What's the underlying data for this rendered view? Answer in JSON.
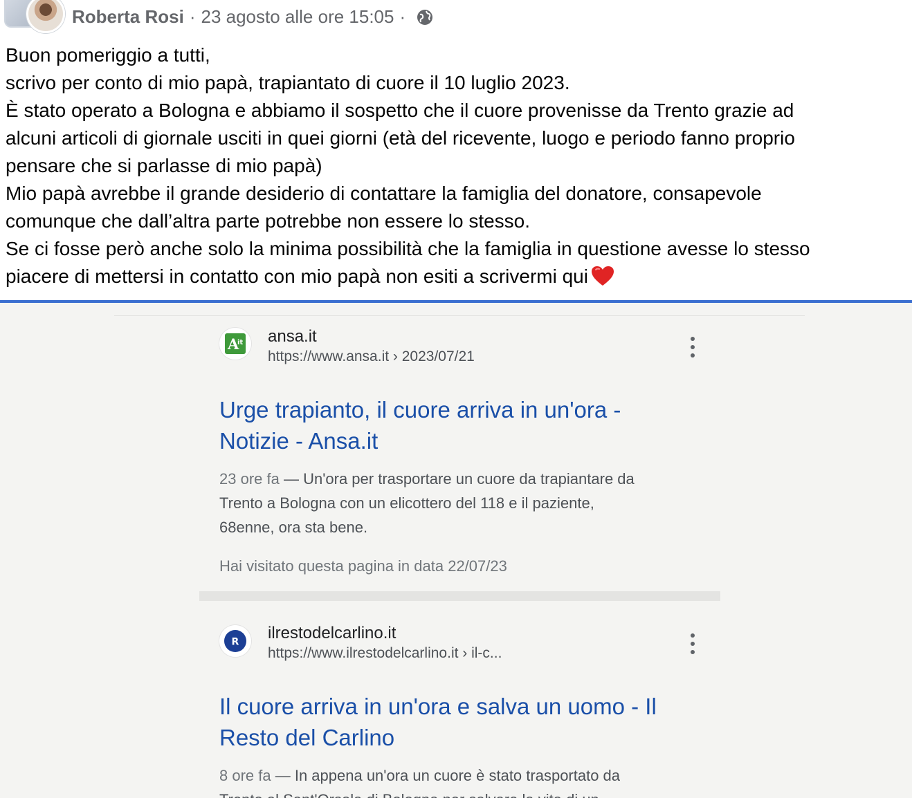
{
  "header": {
    "author": "Roberta Rosi",
    "separator": "·",
    "timestamp": "23 agosto alle ore 15:05"
  },
  "post": {
    "lines": [
      "Buon pomeriggio a tutti,",
      "scrivo per conto di mio papà, trapiantato di cuore il 10 luglio 2023.",
      "È stato operato a Bologna e abbiamo il sospetto che il cuore provenisse da Trento grazie ad",
      "alcuni articoli di giornale usciti in quei giorni (età del ricevente, luogo e periodo fanno proprio",
      "pensare che si parlasse di mio papà)",
      "Mio papà avrebbe il grande desiderio di contattare la famiglia del donatore, consapevole",
      "comunque che dall’altra parte potrebbe non essere lo stesso.",
      "Se ci fosse però anche solo la minima possibilità che la famiglia in questione avesse lo stesso",
      "piacere di mettersi in contatto con mio papà non esiti a scrivermi qui"
    ],
    "emoji": "heart-icon"
  },
  "search_results": [
    {
      "favicon_text": "A",
      "favicon_sub": "it",
      "favicon_color": "#3f9a3b",
      "site": "ansa.it",
      "url": "https://www.ansa.it › 2023/07/21",
      "title_line1": "Urge trapianto, il cuore arriva in un'ora -",
      "title_line2": "Notizie - Ansa.it",
      "age": "23 ore fa",
      "snippet_line1": " — Un'ora per trasportare un cuore da trapiantare da",
      "snippet_line2": "Trento a Bologna con un elicottero del 118 e il paziente,",
      "snippet_line3": "68enne, ora sta bene.",
      "visited": "Hai visitato questa pagina in data 22/07/23"
    },
    {
      "favicon_text": "R",
      "favicon_color": "#1c3f95",
      "site": "ilrestodelcarlino.it",
      "url": "https://www.ilrestodelcarlino.it › il-c...",
      "title_line1": "Il cuore arriva in un'ora e salva un uomo - Il",
      "title_line2": "Resto del Carlino",
      "age": "8 ore fa",
      "snippet_line1": " — In appena un'ora un cuore è stato trasportato da",
      "snippet_line2": "Trento al Sant'Orsola di Bologna per salvare la vita di un"
    }
  ],
  "colors": {
    "divider": "#3b6fd0",
    "link_title": "#1a4fa8",
    "heart": "#e02424"
  }
}
